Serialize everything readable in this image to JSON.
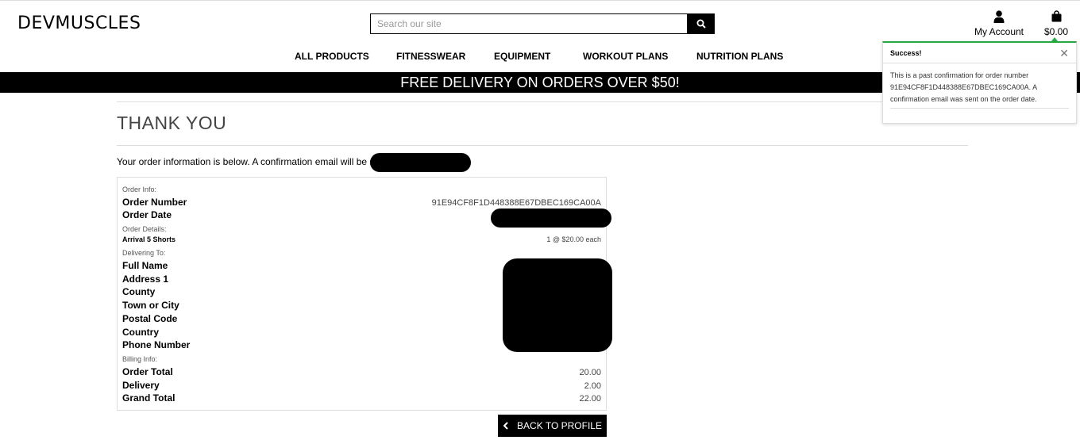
{
  "header": {
    "logo": "DEVMUSCLES",
    "search_placeholder": "Search our site",
    "account_label": "My Account",
    "bag_total": "$0.00"
  },
  "nav": {
    "items": [
      "ALL PRODUCTS",
      "FITNESSWEAR",
      "EQUIPMENT",
      "WORKOUT PLANS",
      "NUTRITION PLANS"
    ]
  },
  "banner": "FREE DELIVERY ON ORDERS OVER $50!",
  "page": {
    "title": "THANK YOU",
    "intro": "Your order information is below. A confirmation email will be sent t"
  },
  "order": {
    "info_heading": "Order Info:",
    "number_label": "Order Number",
    "number_value": "91E94CF8F1D448388E67DBEC169CA00A",
    "date_label": "Order Date",
    "details_heading": "Order Details:",
    "item_name": "Arrival 5 Shorts",
    "item_qty": "1 @ $20.00 each",
    "delivering_heading": "Delivering To:",
    "delivery_labels": [
      "Full Name",
      "Address 1",
      "County",
      "Town or City",
      "Postal Code",
      "Country",
      "Phone Number"
    ],
    "billing_heading": "Billing Info:",
    "order_total_label": "Order Total",
    "order_total_value": "20.00",
    "delivery_label": "Delivery",
    "delivery_value": "2.00",
    "grand_total_label": "Grand Total",
    "grand_total_value": "22.00"
  },
  "back_button": "BACK TO PROFILE",
  "toast": {
    "title": "Success!",
    "message": "This is a past confirmation for order number 91E94CF8F1D448388E67DBEC169CA00A. A confirmation email was sent on the order date."
  },
  "colors": {
    "success_accent": "#28a745",
    "banner_bg": "#000000"
  },
  "icons": {
    "search": "search-icon",
    "account": "user-icon",
    "bag": "shopping-bag-icon",
    "back": "chevron-left-icon",
    "close": "close-icon"
  }
}
